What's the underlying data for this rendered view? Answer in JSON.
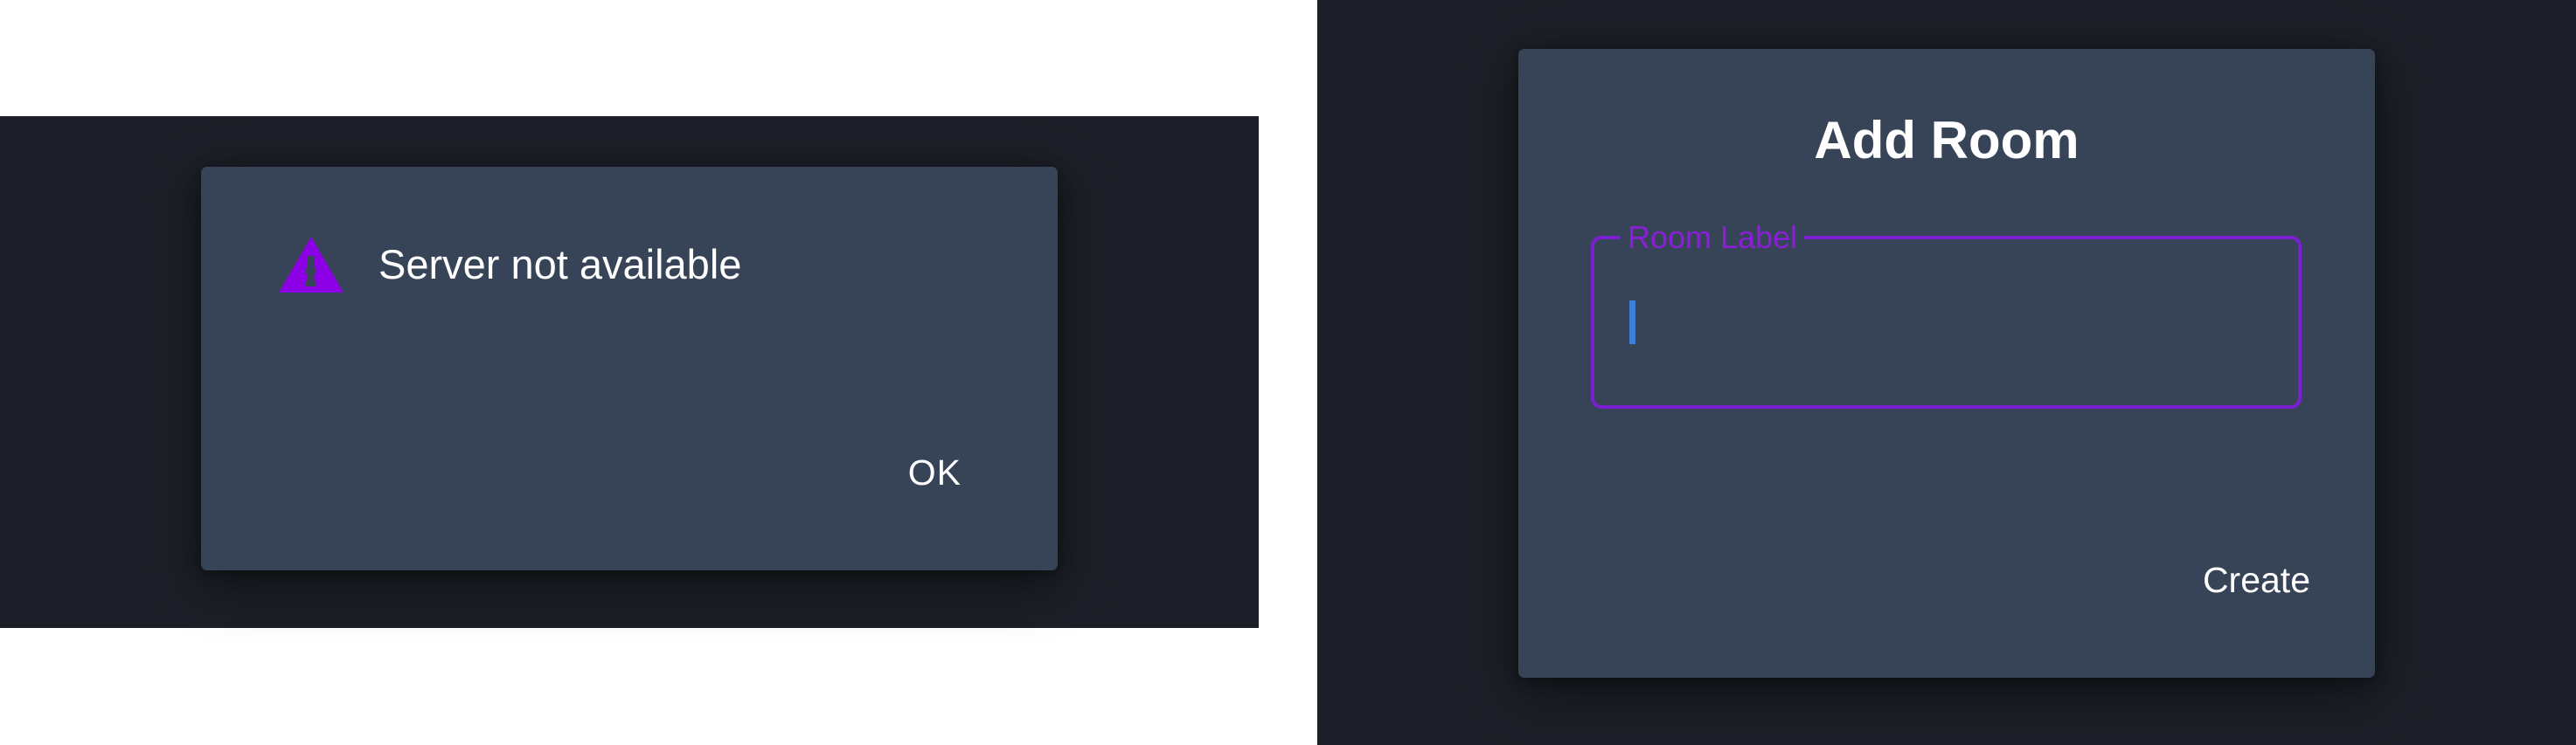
{
  "alert_dialog": {
    "message": "Server not available",
    "ok_label": "OK",
    "icon": "warning-triangle-icon",
    "icon_color": "#8b00e5"
  },
  "add_room_dialog": {
    "title": "Add Room",
    "room_label_field": {
      "label": "Room Label",
      "value": ""
    },
    "create_label": "Create",
    "field_border_color": "#7b1fd2",
    "caret_color": "#3f7fd9"
  },
  "colors": {
    "backdrop": "#1c1f27",
    "dialog_surface": "#374357",
    "text": "#ffffff"
  }
}
